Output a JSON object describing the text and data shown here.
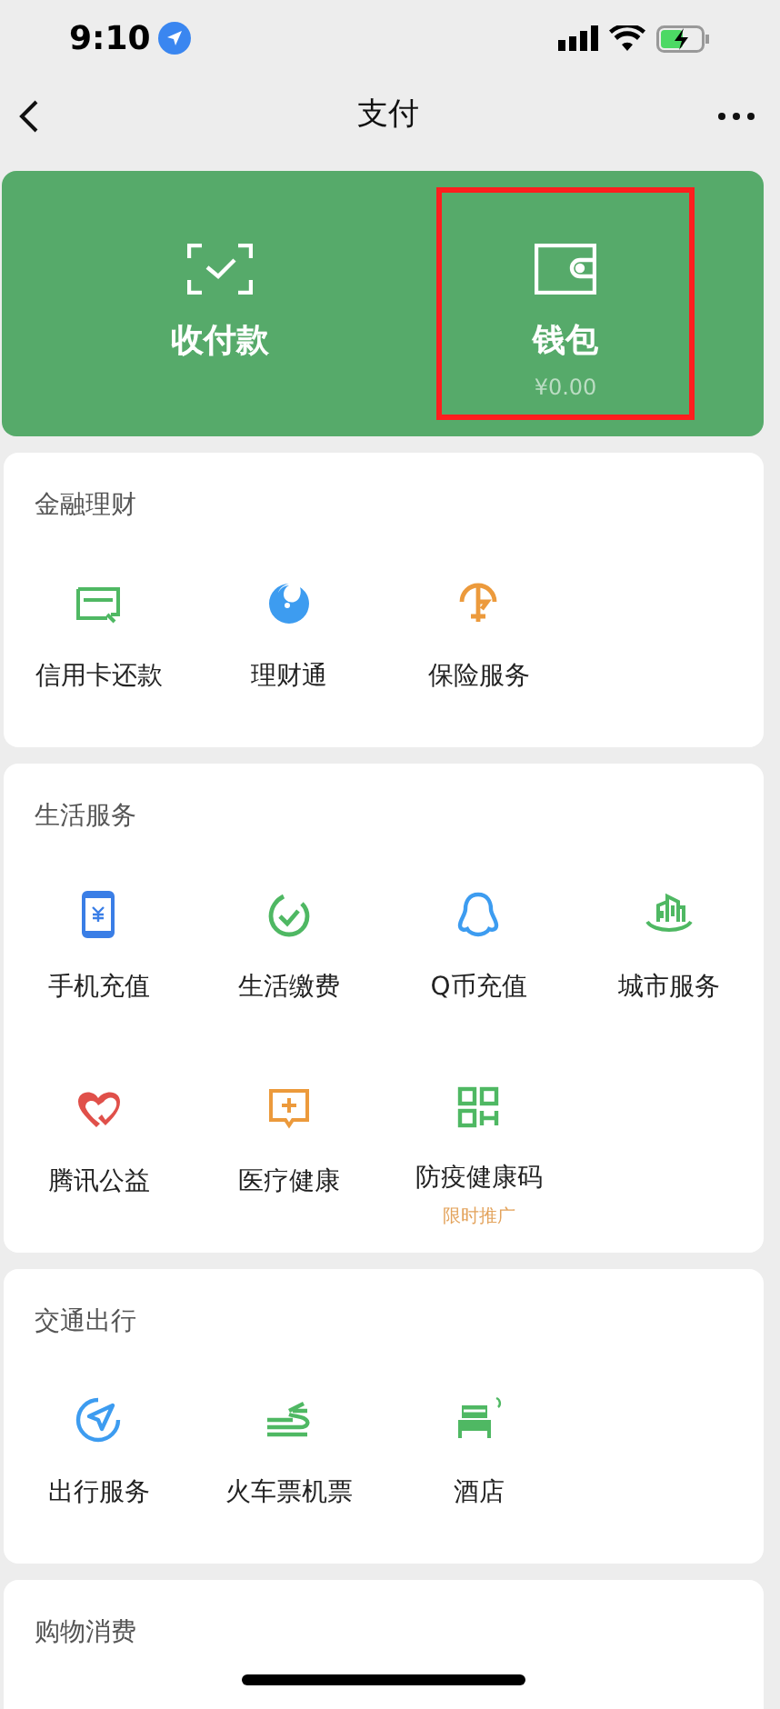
{
  "status_bar": {
    "time": "9:10"
  },
  "nav": {
    "title": "支付"
  },
  "top_actions": [
    {
      "label": "收付款",
      "highlighted": false
    },
    {
      "label": "钱包",
      "amount": "¥0.00",
      "highlighted": true
    }
  ],
  "sections": [
    {
      "title": "金融理财",
      "items": [
        {
          "label": "信用卡还款"
        },
        {
          "label": "理财通"
        },
        {
          "label": "保险服务"
        }
      ]
    },
    {
      "title": "生活服务",
      "items": [
        {
          "label": "手机充值"
        },
        {
          "label": "生活缴费"
        },
        {
          "label": "Q币充值"
        },
        {
          "label": "城市服务"
        },
        {
          "label": "腾讯公益"
        },
        {
          "label": "医疗健康"
        },
        {
          "label": "防疫健康码",
          "note": "限时推广"
        }
      ]
    },
    {
      "title": "交通出行",
      "items": [
        {
          "label": "出行服务"
        },
        {
          "label": "火车票机票"
        },
        {
          "label": "酒店"
        }
      ]
    },
    {
      "title": "购物消费"
    }
  ]
}
